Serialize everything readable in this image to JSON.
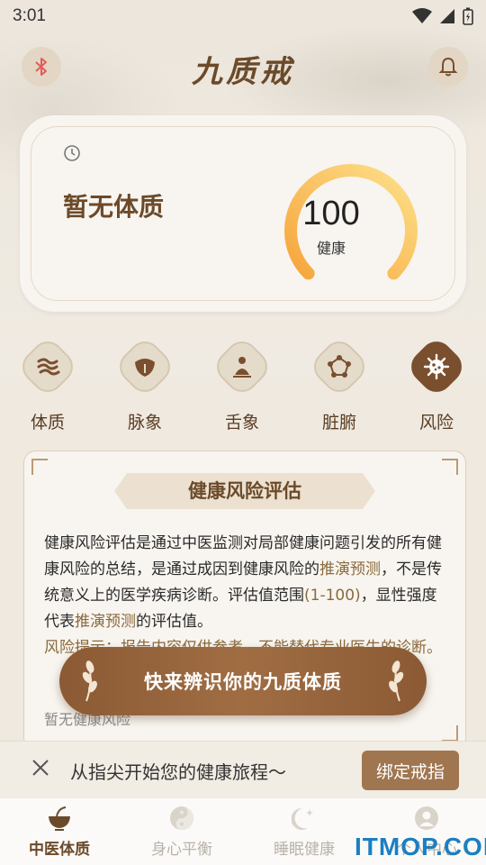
{
  "status_bar": {
    "time": "3:01"
  },
  "header": {
    "logo": "九质戒",
    "left_icon": "bluetooth-icon",
    "right_icon": "bell-icon"
  },
  "score_card": {
    "constitution": "暂无体质",
    "score": "100",
    "score_label": "健康",
    "gauge_fraction": 1.0,
    "gauge_colors": [
      "#f6a53c",
      "#fde08a"
    ]
  },
  "categories": [
    {
      "label": "体质",
      "icon": "cloud-wave-icon",
      "active": false
    },
    {
      "label": "脉象",
      "icon": "pulse-icon",
      "active": false
    },
    {
      "label": "舌象",
      "icon": "tongue-icon",
      "active": false
    },
    {
      "label": "脏腑",
      "icon": "organ-pentagon-icon",
      "active": false
    },
    {
      "label": "风险",
      "icon": "virus-icon",
      "active": true
    }
  ],
  "risk_card": {
    "title": "健康风险评估",
    "text_1": "健康风险评估是通过中医监测对局部健康问题引发的所有健康风险的总结，是通过成因到健康风险的",
    "text_hl_1": "推演预测",
    "text_2": "，不是传统意义上的医学疾病诊断。评估值范围",
    "text_hl_2": "(1-100)",
    "text_3": "，显性强度代表",
    "text_hl_3": "推演预测",
    "text_4": "的评估值。",
    "warning": "风险提示：报告内容仅供参考，不能替代专业医生的诊断。",
    "empty": "暂无健康风险"
  },
  "cta": {
    "label": "快来辨识你的九质体质"
  },
  "bind_bar": {
    "text": "从指尖开始您的健康旅程～",
    "button": "绑定戒指"
  },
  "tabbar": [
    {
      "label": "中医体质",
      "icon": "herb-bowl-icon",
      "active": true
    },
    {
      "label": "身心平衡",
      "icon": "yin-yang-icon",
      "active": false
    },
    {
      "label": "睡眠健康",
      "icon": "moon-star-icon",
      "active": false
    },
    {
      "label": "个人中心",
      "icon": "user-icon",
      "active": false
    }
  ],
  "watermark": "ITMOP.COM",
  "colors": {
    "brand": "#6b4a2a",
    "accent": "#a07650"
  }
}
